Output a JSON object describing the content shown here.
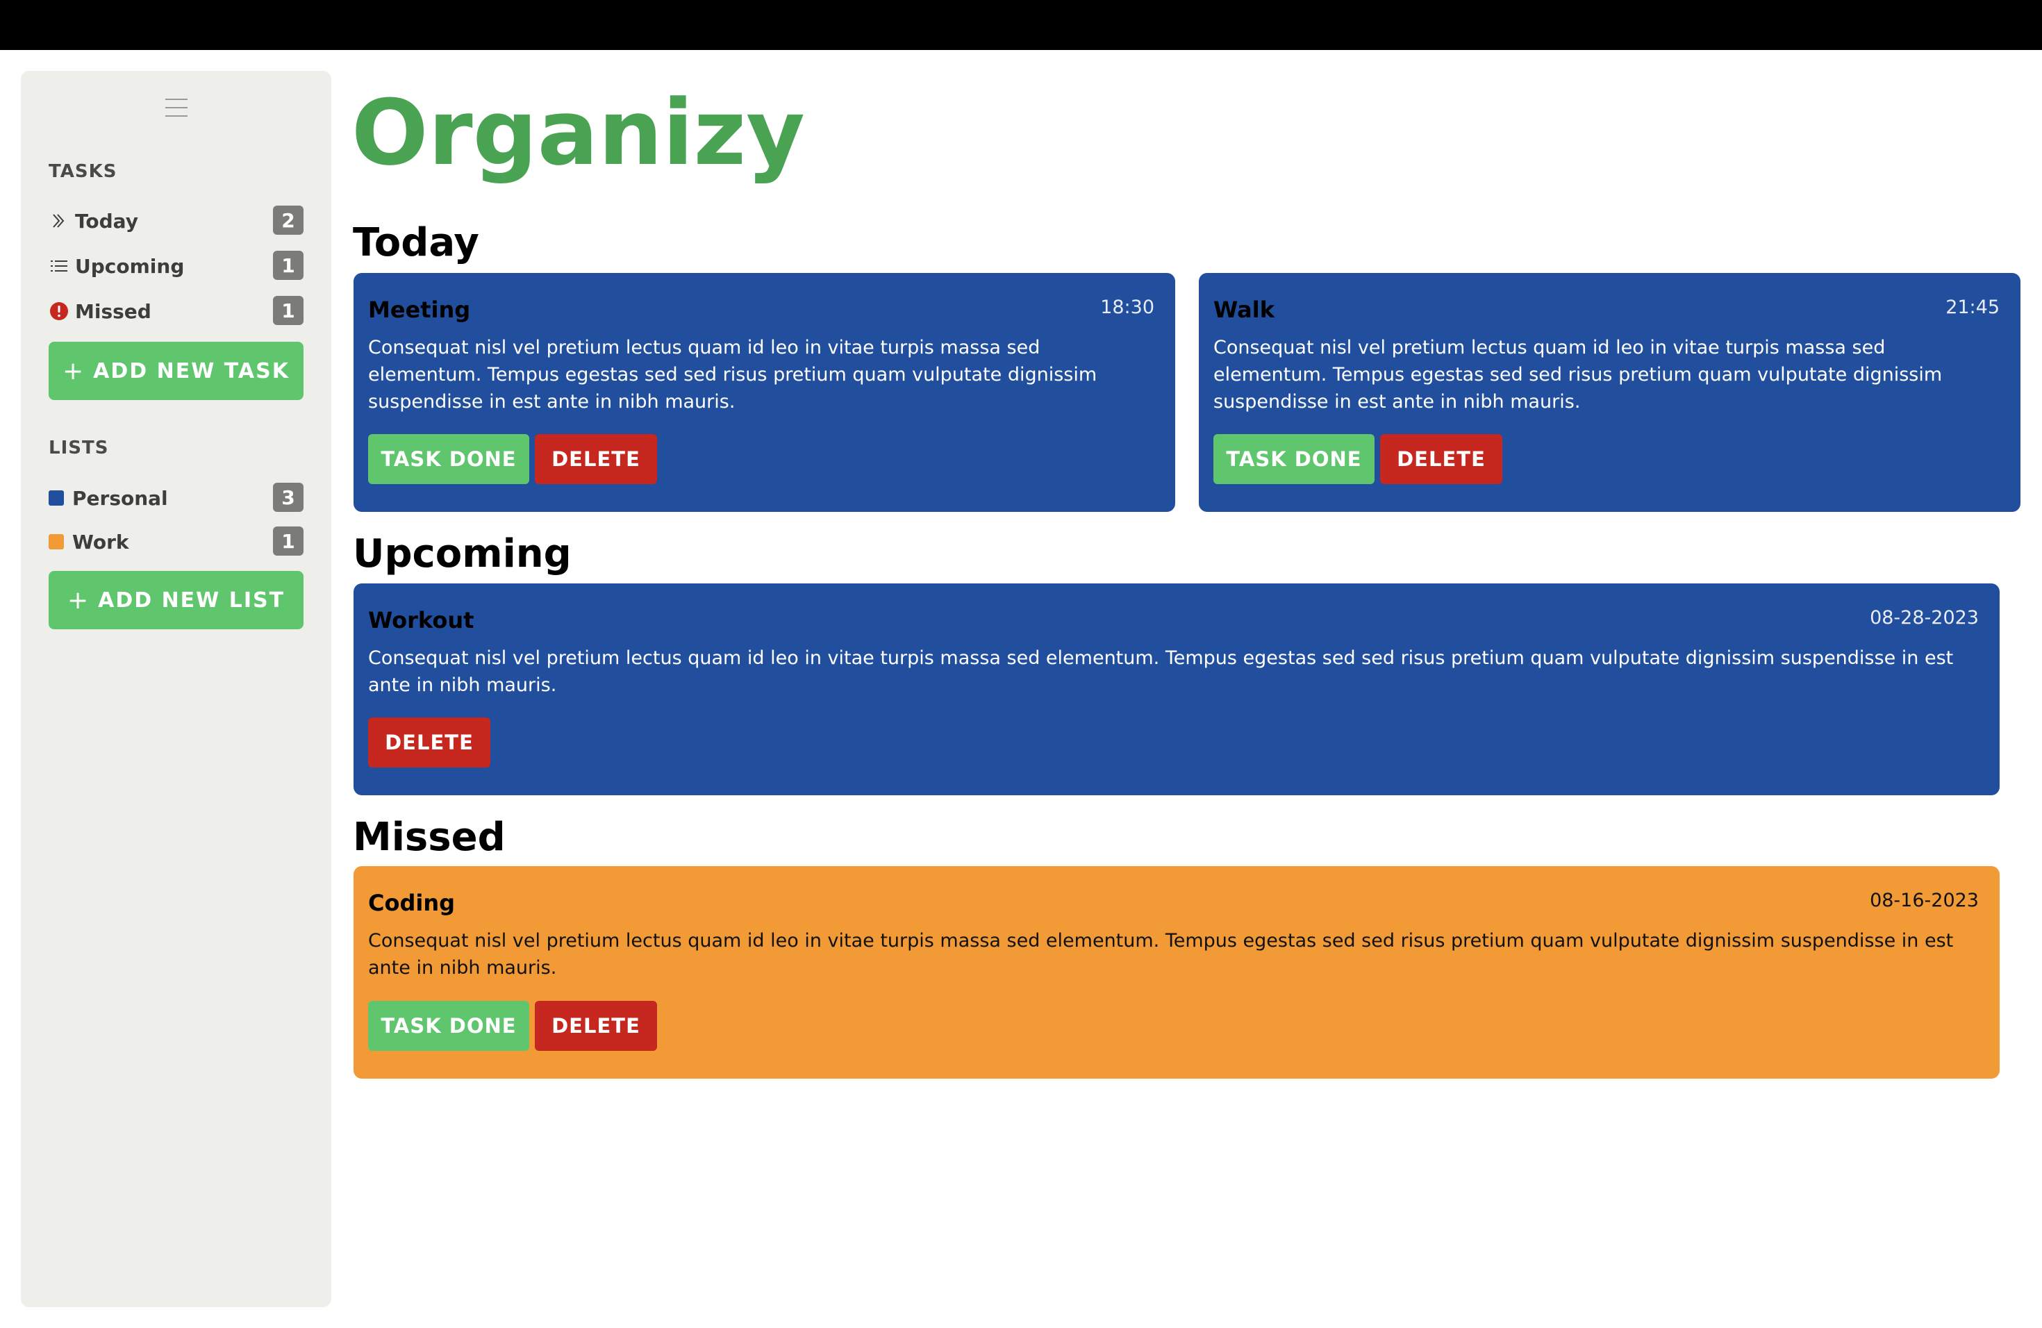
{
  "app": {
    "title": "Organizy"
  },
  "colors": {
    "accent": "#4aa353",
    "task_blue": "#214f9d",
    "task_orange": "#f19a36",
    "done_green": "#60c66e",
    "delete_red": "#c6281f",
    "missed_icon": "#c6281f"
  },
  "sidebar": {
    "tasks_heading": "TASKS",
    "nav": [
      {
        "label": "Today",
        "count": "2",
        "icon": "double-chevron-right-icon"
      },
      {
        "label": "Upcoming",
        "count": "1",
        "icon": "list-icon"
      },
      {
        "label": "Missed",
        "count": "1",
        "icon": "alert-circle-icon"
      }
    ],
    "add_task_label": "ADD NEW TASK",
    "lists_heading": "LISTS",
    "lists": [
      {
        "label": "Personal",
        "count": "3",
        "color": "#214f9d"
      },
      {
        "label": "Work",
        "count": "1",
        "color": "#f19a36"
      }
    ],
    "add_list_label": "ADD NEW LIST"
  },
  "sections": {
    "today": {
      "title": "Today",
      "tasks": [
        {
          "title": "Meeting",
          "time": "18:30",
          "desc": "Consequat nisl vel pretium lectus quam id leo in vitae turpis massa sed elementum. Tempus egestas sed sed risus pretium quam vulputate dignissim suspendisse in est ante in nibh mauris.",
          "done_label": "TASK DONE",
          "delete_label": "DELETE"
        },
        {
          "title": "Walk",
          "time": "21:45",
          "desc": "Consequat nisl vel pretium lectus quam id leo in vitae turpis massa sed elementum. Tempus egestas sed sed risus pretium quam vulputate dignissim suspendisse in est ante in nibh mauris.",
          "done_label": "TASK DONE",
          "delete_label": "DELETE"
        }
      ]
    },
    "upcoming": {
      "title": "Upcoming",
      "tasks": [
        {
          "title": "Workout",
          "time": "08-28-2023",
          "desc": "Consequat nisl vel pretium lectus quam id leo in vitae turpis massa sed elementum. Tempus egestas sed sed risus pretium quam vulputate dignissim suspendisse in est ante in nibh mauris.",
          "delete_label": "DELETE"
        }
      ]
    },
    "missed": {
      "title": "Missed",
      "tasks": [
        {
          "title": "Coding",
          "time": "08-16-2023",
          "desc": "Consequat nisl vel pretium lectus quam id leo in vitae turpis massa sed elementum. Tempus egestas sed sed risus pretium quam vulputate dignissim suspendisse in est ante in nibh mauris.",
          "done_label": "TASK DONE",
          "delete_label": "DELETE"
        }
      ]
    }
  }
}
